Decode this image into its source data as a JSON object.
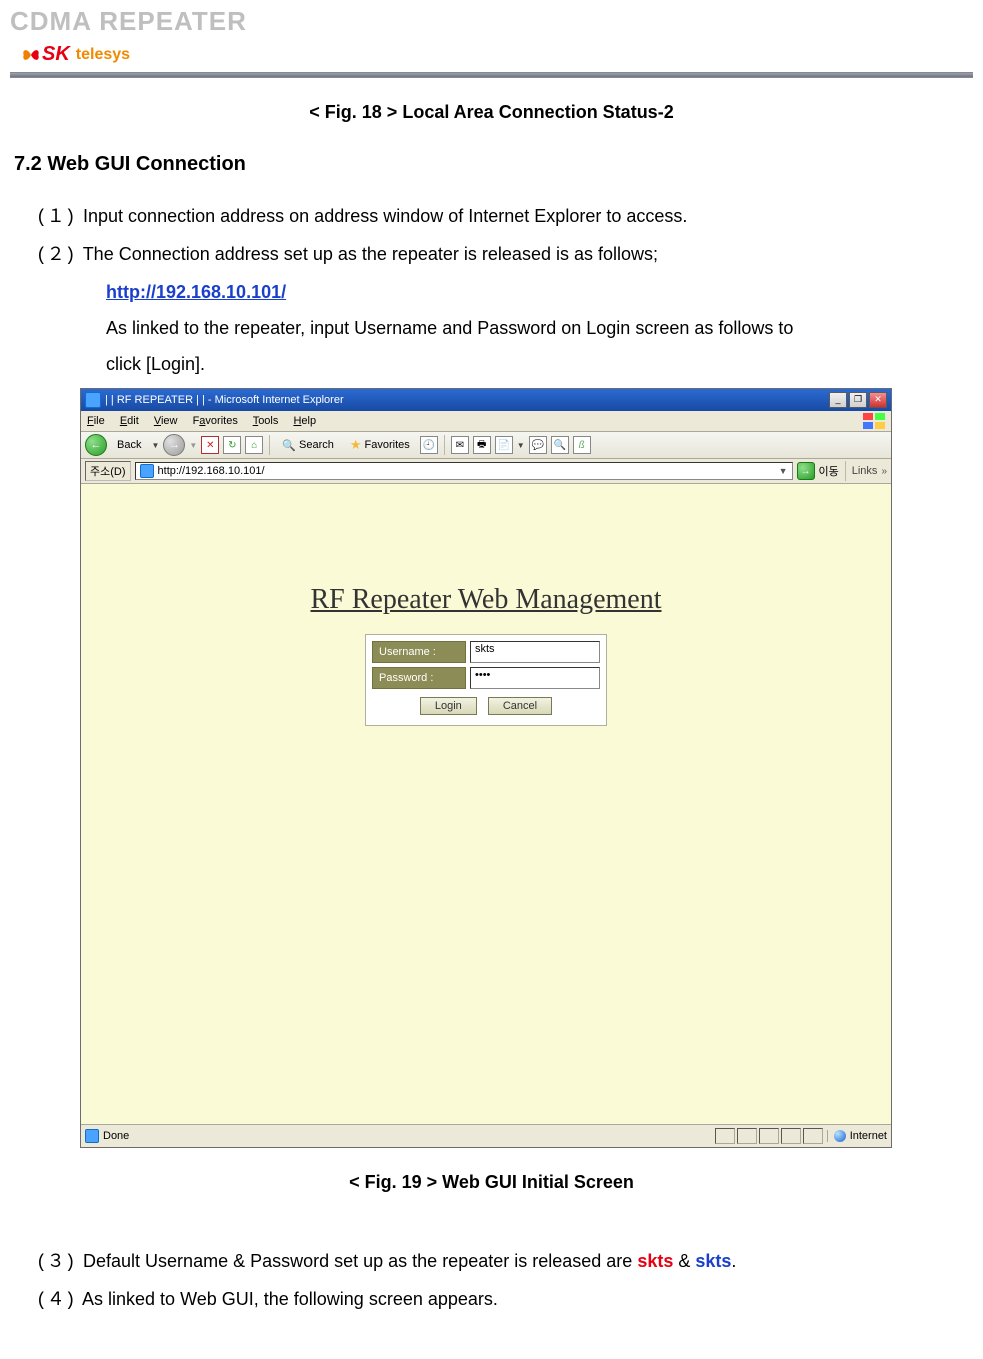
{
  "doc_header": "CDMA REPEATER",
  "logo": {
    "sk": "SK",
    "telesys": "telesys"
  },
  "fig18": "< Fig. 18 > Local Area Connection Status-2",
  "section72": "7.2  Web GUI Connection",
  "step1_num": "(１)",
  "step1": "Input connection address on address window of Internet Explorer to access.",
  "step2_num": "(２)",
  "step2": "The Connection address set up as the repeater is released is as follows;",
  "url": "http://192.168.10.101/",
  "after_url_1": "As linked to the repeater, input Username and Password on Login screen as follows    to",
  "after_url_2": "click [Login].",
  "fig19": "< Fig. 19 > Web GUI Initial Screen",
  "step3_num": "(３)",
  "step3_a": "Default Username & Password set up as the repeater is released are ",
  "step3_skts1": "skts",
  "step3_b": " & ",
  "step3_skts2": "skts",
  "step3_c": ".",
  "step4_num": "(４)",
  "step4": "As linked to Web GUI, the following screen appears.",
  "ie": {
    "title": "| | RF REPEATER | |  - Microsoft Internet Explorer",
    "menu": {
      "file": "File",
      "edit": "Edit",
      "view": "View",
      "fav": "Favorites",
      "tools": "Tools",
      "help": "Help"
    },
    "tb": {
      "back": "Back",
      "search": "Search",
      "favorites": "Favorites"
    },
    "addr_label": "주소(D)",
    "addr_value": "http://192.168.10.101/",
    "go_label": "이동",
    "links": "Links",
    "rf_title": "RF Repeater Web Management",
    "username_lbl": "Username :",
    "password_lbl": "Password :",
    "username_val": "skts",
    "password_val": "••••",
    "login_btn": "Login",
    "cancel_btn": "Cancel",
    "status_done": "Done",
    "status_zone": "Internet"
  }
}
